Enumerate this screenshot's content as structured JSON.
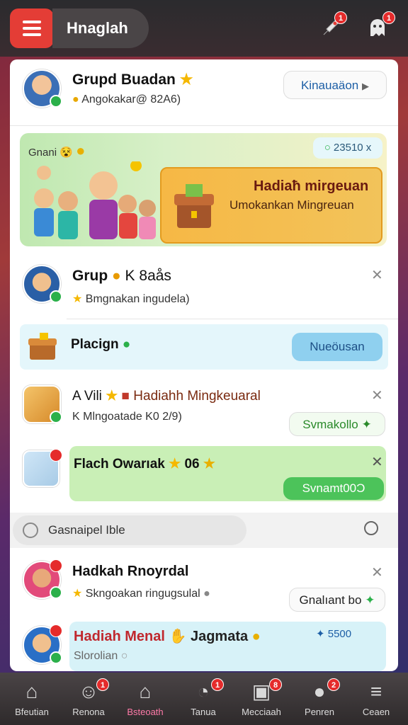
{
  "header": {
    "title": "Hnaglah",
    "menu_icon": "hamburger-icon",
    "icons": [
      {
        "name": "rocket-icon",
        "badge": "1"
      },
      {
        "name": "ghost-icon",
        "badge": "1"
      }
    ]
  },
  "group_header": {
    "name": "Grupd Buadan",
    "sub": "Angokakar@ 82A6)",
    "button": "Kinauaäon"
  },
  "promo": {
    "top_left": "Gnani",
    "counter": "23510 x",
    "title": "Hadiaħ mirgeuan",
    "subtitle": "Umokankan Mingreuan"
  },
  "items": [
    {
      "name": "Grup",
      "name_suffix": "K 8aås",
      "sub": "Bmgnakan ingudela)"
    },
    {
      "name": "Placign",
      "button": "Nueöusan"
    },
    {
      "name": "A Vili",
      "name_suffix": "Hadiahh Mingkeuaral",
      "sub": "K Mlngoatade K0 2/9)",
      "button": "Svmakollo"
    },
    {
      "name": "Flach Owarıak",
      "name_suffix": "06",
      "button": "Svnamt00Ɔ"
    }
  ],
  "search": {
    "placeholder": "Gasnaipel Ible"
  },
  "lower_items": [
    {
      "name": "Hadkah Rnoyrdal",
      "sub": "Skngoakan ringugsulal",
      "button": "Gnalıant bo"
    },
    {
      "name": "Hadiah Menal",
      "name_suffix": "Jagmata",
      "sub": "Slorolian",
      "counter": "5500"
    }
  ],
  "bottom_nav": [
    {
      "label": "Bfeutian",
      "icon": "home-icon"
    },
    {
      "label": "Renona",
      "icon": "face-icon",
      "badge": "1"
    },
    {
      "label": "Bsteoath",
      "icon": "house-icon",
      "active": true
    },
    {
      "label": "Tanua",
      "icon": "clock-icon",
      "badge": "1"
    },
    {
      "label": "Mecciaah",
      "icon": "gift-icon",
      "badge": "8"
    },
    {
      "label": "Penren",
      "icon": "person-icon",
      "badge": "2"
    },
    {
      "label": "Ceaen",
      "icon": "menu-lines-icon"
    }
  ],
  "colors": {
    "accent_red": "#e43d36",
    "green": "#2bb04a",
    "blue_button": "#8fd0ef",
    "promo_orange": "#f3b33a"
  }
}
